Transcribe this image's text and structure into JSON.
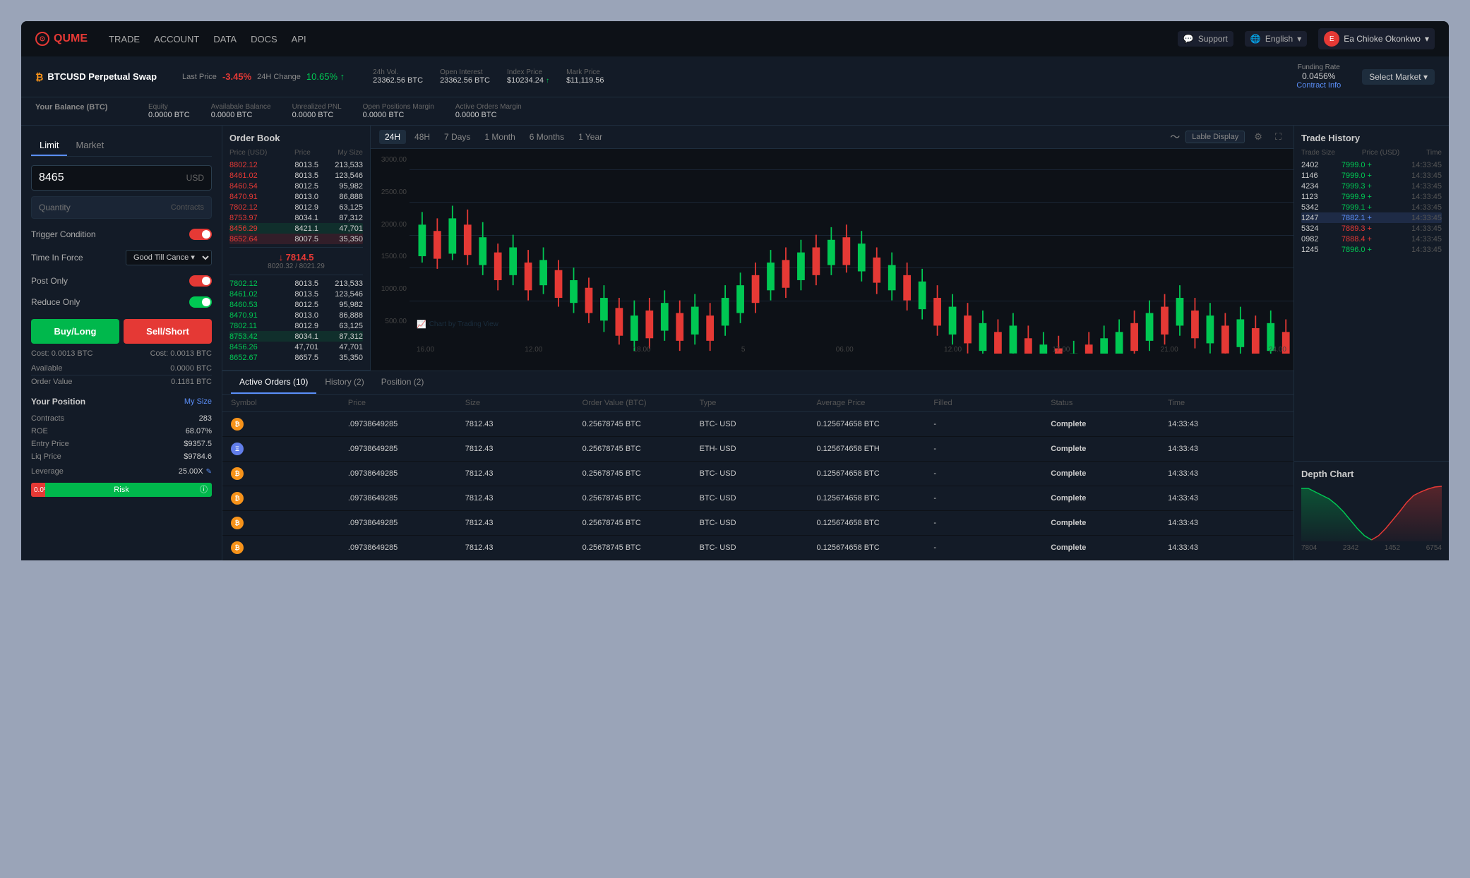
{
  "app": {
    "name": "QUME",
    "logo_text": "QUME"
  },
  "navbar": {
    "links": [
      "TRADE",
      "ACCOUNT",
      "DATA",
      "DOCS",
      "API"
    ],
    "support_label": "Support",
    "language_label": "English",
    "user_label": "Ea Chioke Okonkwo"
  },
  "market": {
    "symbol": "BTCUSD Perpetual Swap",
    "coin": "B",
    "last_price_label": "Last Price",
    "last_price": "-3.45%",
    "change_label": "24H Change",
    "change_val": "10.65% ↑",
    "vol_label": "24h Vol.",
    "vol_val": "23362.56 BTC",
    "open_interest_label": "Open Interest",
    "open_interest_val": "23362.56 BTC",
    "index_price_label": "Index Price",
    "index_price_val": "$10234.24",
    "mark_price_label": "Mark Price",
    "mark_price_val": "$11,119.56",
    "funding_rate_label": "Funding Rate",
    "funding_rate_val": "0.0456%",
    "contract_info_label": "Contract Info",
    "select_market_label": "Select Market ▾"
  },
  "balance": {
    "title": "Your Balance (BTC)",
    "equity_label": "Equity",
    "equity_val": "0.0000 BTC",
    "avail_label": "Availabale Balance",
    "avail_val": "0.0000 BTC",
    "unrealized_label": "Unrealized PNL",
    "unrealized_val": "0.0000 BTC",
    "open_margin_label": "Open Positions Margin",
    "open_margin_val": "0.0000 BTC",
    "active_margin_label": "Active Orders Margin",
    "active_margin_val": "0.0000 BTC"
  },
  "order_form": {
    "tab_limit": "Limit",
    "tab_market": "Market",
    "price_value": "8465",
    "price_currency": "USD",
    "qty_placeholder": "Quantity",
    "qty_unit": "Contracts",
    "trigger_label": "Trigger Condition",
    "time_force_label": "Time In Force",
    "time_force_val": "Good Till Cance ▾",
    "post_only_label": "Post Only",
    "reduce_only_label": "Reduce Only",
    "buy_btn": "Buy/Long",
    "sell_btn": "Sell/Short",
    "cost_buy": "Cost: 0.0013 BTC",
    "cost_sell": "Cost: 0.0013 BTC",
    "available_label": "Available",
    "available_val": "0.0000 BTC",
    "order_value_label": "Order Value",
    "order_value_val": "0.1181 BTC"
  },
  "position": {
    "title": "Your Position",
    "my_size_label": "My Size",
    "contracts_label": "Contracts",
    "contracts_val": "283",
    "roe_label": "ROE",
    "roe_val": "68.07%",
    "entry_label": "Entry Price",
    "entry_val": "$9357.5",
    "liq_label": "Liq Price",
    "liq_val": "$9784.6",
    "leverage_label": "Leverage",
    "leverage_val": "25.00X",
    "risk_pct": "0.0%",
    "risk_label": "Risk"
  },
  "orderbook": {
    "title": "Order Book",
    "col_price": "Price (USD)",
    "col_size": "Price",
    "col_mysize": "My Size",
    "asks": [
      {
        "price": "8802.12",
        "size": "8013.5",
        "mysize": "213,533"
      },
      {
        "price": "8461.02",
        "size": "8013.5",
        "mysize": "123,546"
      },
      {
        "price": "8460.54",
        "size": "8012.5",
        "mysize": "95,982"
      },
      {
        "price": "8470.91",
        "size": "8013.0",
        "mysize": "86,888"
      },
      {
        "price": "7802.12",
        "size": "8012.9",
        "mysize": "63,125"
      },
      {
        "price": "8753.97",
        "size": "8034.1",
        "mysize": "87,312"
      },
      {
        "price": "8456.29",
        "size": "8421.1",
        "mysize": "47,701"
      },
      {
        "price": "8652.64",
        "size": "8007.5",
        "mysize": "35,350"
      }
    ],
    "mid_price": "↓ 7814.5",
    "mid_sub": "8020.32 / 8021.29",
    "bids": [
      {
        "price": "7802.12",
        "size": "8013.5",
        "mysize": "213,533"
      },
      {
        "price": "8461.02",
        "size": "8013.5",
        "mysize": "123,546"
      },
      {
        "price": "8460.53",
        "size": "8012.5",
        "mysize": "95,982"
      },
      {
        "price": "8470.91",
        "size": "8013.0",
        "mysize": "86,888"
      },
      {
        "price": "7802.11",
        "size": "8012.9",
        "mysize": "63,125"
      },
      {
        "price": "8753.42",
        "size": "8034.1",
        "mysize": "87,312"
      },
      {
        "price": "8456.26",
        "size": "47,701",
        "mysize": "47,701"
      },
      {
        "price": "8652.67",
        "size": "8657.5",
        "mysize": "35,350"
      }
    ]
  },
  "chart": {
    "tabs": [
      "24H",
      "48H",
      "7 Days",
      "1 Month",
      "6 Months",
      "1 Year"
    ],
    "active_tab": "24H",
    "label_display": "Lable Display",
    "y_labels": [
      "3000.00",
      "2500.00",
      "2000.00",
      "1500.00",
      "1000.00",
      "500.00"
    ],
    "x_labels": [
      "16.00",
      "12.00",
      "18.00",
      "5",
      "06.00",
      "12.00",
      "17.00",
      "21.00",
      "24.00"
    ],
    "watermark": "Chart by Trading View"
  },
  "trade_history": {
    "title": "Trade History",
    "col_size": "Trade Size",
    "col_price": "Price (USD)",
    "col_time": "Time",
    "trades": [
      {
        "size": "2402",
        "price": "7999.0 +",
        "color": "green",
        "time": "14:33:45"
      },
      {
        "size": "1146",
        "price": "7999.0 +",
        "color": "green",
        "time": "14:33:45"
      },
      {
        "size": "4234",
        "price": "7999.3 +",
        "color": "green",
        "time": "14:33:45"
      },
      {
        "size": "1123",
        "price": "7999.9 +",
        "color": "green",
        "time": "14:33:45"
      },
      {
        "size": "5342",
        "price": "7999.1 +",
        "color": "green",
        "time": "14:33:45"
      },
      {
        "size": "1247",
        "price": "7882.1 +",
        "color": "green",
        "time": "14:33:45",
        "active": true
      },
      {
        "size": "5324",
        "price": "7889.3 +",
        "color": "red",
        "time": "14:33:45"
      },
      {
        "size": "0982",
        "price": "7888.4 +",
        "color": "red",
        "time": "14:33:45"
      },
      {
        "size": "1245",
        "price": "7896.0 +",
        "color": "green",
        "time": "14:33:45"
      }
    ]
  },
  "depth_chart": {
    "title": "Depth Chart",
    "labels": [
      "7804",
      "2342",
      "1452",
      "6754"
    ]
  },
  "active_orders": {
    "tab_active": "Active Orders (10)",
    "tab_history": "History (2)",
    "tab_position": "Position (2)",
    "col_symbol": "Symbol",
    "col_price": "Price",
    "col_size": "Size",
    "col_order_value": "Order Value (BTC)",
    "col_type": "Type",
    "col_avg_price": "Average Price",
    "col_filled": "Filled",
    "col_status": "Status",
    "col_time": "Time",
    "orders": [
      {
        "symbol": "BTC",
        "price": ".09738649285",
        "size": "7812.43",
        "order_value": "0.25678745 BTC",
        "type": "BTC- USD",
        "avg_price": "0.125674658 BTC",
        "filled": "-",
        "status": "Complete",
        "time": "14:33:43"
      },
      {
        "symbol": "ETH",
        "price": ".09738649285",
        "size": "7812.43",
        "order_value": "0.25678745 BTC",
        "type": "ETH- USD",
        "avg_price": "0.125674658 ETH",
        "filled": "-",
        "status": "Complete",
        "time": "14:33:43"
      },
      {
        "symbol": "BTC",
        "price": ".09738649285",
        "size": "7812.43",
        "order_value": "0.25678745 BTC",
        "type": "BTC- USD",
        "avg_price": "0.125674658 BTC",
        "filled": "-",
        "status": "Complete",
        "time": "14:33:43"
      },
      {
        "symbol": "BTC",
        "price": ".09738649285",
        "size": "7812.43",
        "order_value": "0.25678745 BTC",
        "type": "BTC- USD",
        "avg_price": "0.125674658 BTC",
        "filled": "-",
        "status": "Complete",
        "time": "14:33:43"
      },
      {
        "symbol": "BTC",
        "price": ".09738649285",
        "size": "7812.43",
        "order_value": "0.25678745 BTC",
        "type": "BTC- USD",
        "avg_price": "0.125674658 BTC",
        "filled": "-",
        "status": "Complete",
        "time": "14:33:43"
      },
      {
        "symbol": "BTC",
        "price": ".09738649285",
        "size": "7812.43",
        "order_value": "0.25678745 BTC",
        "type": "BTC- USD",
        "avg_price": "0.125674658 BTC",
        "filled": "-",
        "status": "Complete",
        "time": "14:33:43"
      }
    ]
  },
  "colors": {
    "bg_dark": "#0d1117",
    "bg_panel": "#131b27",
    "accent_blue": "#5b8ff9",
    "accent_red": "#e53935",
    "accent_green": "#00c853",
    "text_muted": "#666666",
    "text_dim": "#888888",
    "border": "#1e2d3d"
  }
}
